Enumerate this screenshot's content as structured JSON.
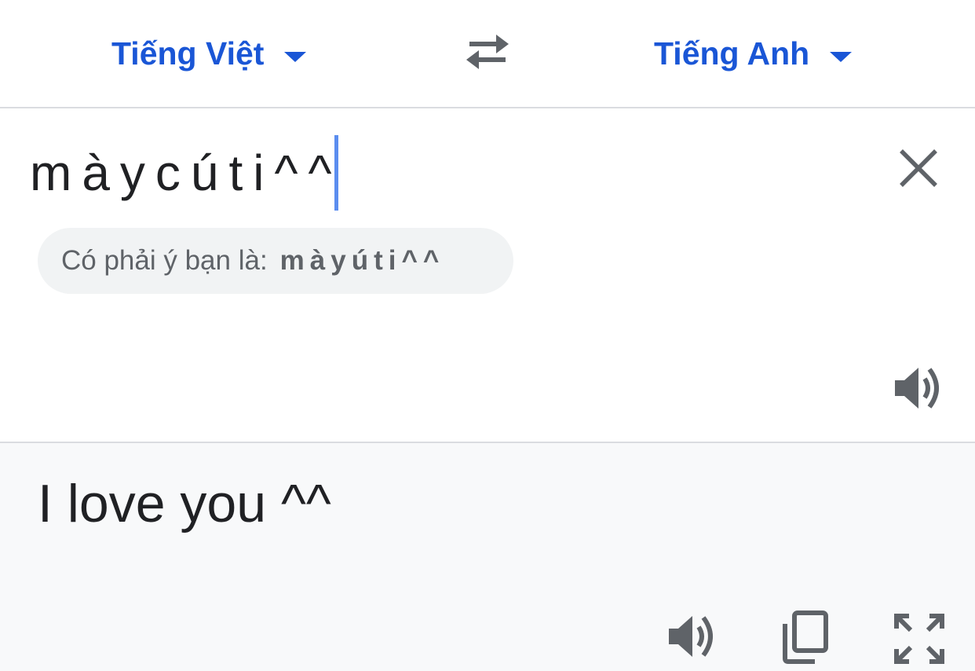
{
  "languages": {
    "source_label": "Tiếng Việt",
    "target_label": "Tiếng Anh"
  },
  "icons": {
    "swap": "swap-icon",
    "dropdown": "caret-down-icon",
    "clear": "close-icon",
    "speak": "speaker-icon",
    "copy": "copy-icon",
    "fullscreen": "fullscreen-icon"
  },
  "source": {
    "input_value": "màycúti^^",
    "suggestion_label": "Có phải ý bạn là:",
    "suggestion_value": "màyúti^^"
  },
  "result": {
    "text": "I love you ^^"
  },
  "colors": {
    "accent": "#1a56d6",
    "cursor": "#5b8def",
    "icon": "#5f6368",
    "result_bg": "#f8f9fa",
    "chip_bg": "#f1f3f4"
  }
}
